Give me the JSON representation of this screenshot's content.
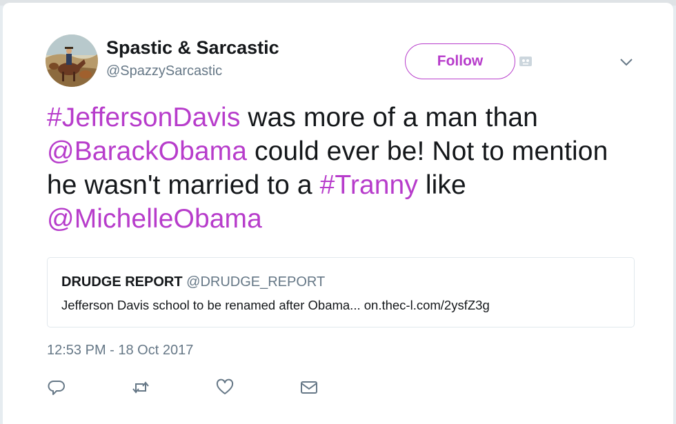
{
  "tweet": {
    "author": {
      "display_name": "Spastic & Sarcastic",
      "handle": "@SpazzySarcastic",
      "avatar_icon": "cowboy-painting-avatar"
    },
    "follow_label": "Follow",
    "text_segments": [
      {
        "text": "#JeffersonDavis",
        "link": true
      },
      {
        "text": " was more of a man than ",
        "link": false
      },
      {
        "text": "@BarackObama",
        "link": true
      },
      {
        "text": " could ever be! Not to mention he wasn't married to a ",
        "link": false
      },
      {
        "text": "#Tranny",
        "link": true
      },
      {
        "text": " like ",
        "link": false
      },
      {
        "text": "@MichelleObama",
        "link": true
      }
    ],
    "quote": {
      "name": "DRUDGE REPORT",
      "handle": "@DRUDGE_REPORT",
      "text": "Jefferson Davis school to be renamed after Obama... on.thec-l.com/2ysfZ3g"
    },
    "timestamp": "12:53 PM - 18 Oct 2017",
    "actions": [
      "reply-icon",
      "retweet-icon",
      "like-icon",
      "direct-message-icon"
    ]
  },
  "colors": {
    "link": "#b73ccb",
    "text": "#14171a",
    "secondary": "#657786",
    "border": "#e1e8ed"
  }
}
